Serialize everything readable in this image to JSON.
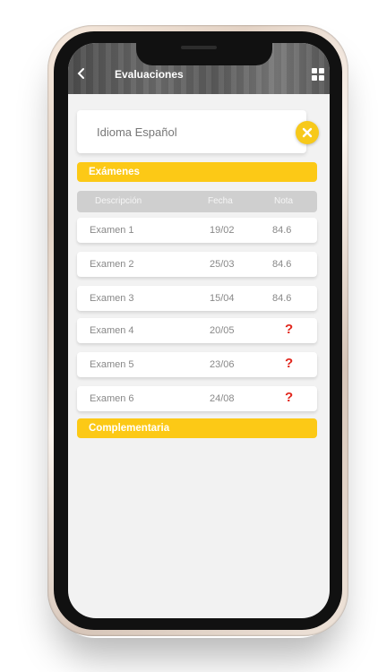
{
  "header": {
    "title": "Evaluaciones",
    "back_icon": "chevron-left-icon",
    "menu_icon": "grid-icon"
  },
  "course": {
    "name": "Idioma Español",
    "close_icon": "close-icon",
    "accent": "#fcc916"
  },
  "sections": {
    "exams_label": "Exámenes",
    "complementary_label": "Complementaria"
  },
  "table": {
    "columns": [
      "Descripción",
      "Fecha",
      "Nota"
    ],
    "rows": [
      {
        "description": "Examen 1",
        "date": "19/02",
        "grade": "84.6"
      },
      {
        "description": "Examen 2",
        "date": "25/03",
        "grade": "84.6"
      },
      {
        "description": "Examen 3",
        "date": "15/04",
        "grade": "84.6"
      },
      {
        "description": "Examen 4",
        "date": "20/05",
        "grade": "?"
      },
      {
        "description": "Examen 5",
        "date": "23/06",
        "grade": "?"
      },
      {
        "description": "Examen 6",
        "date": "24/08",
        "grade": "?"
      }
    ]
  }
}
